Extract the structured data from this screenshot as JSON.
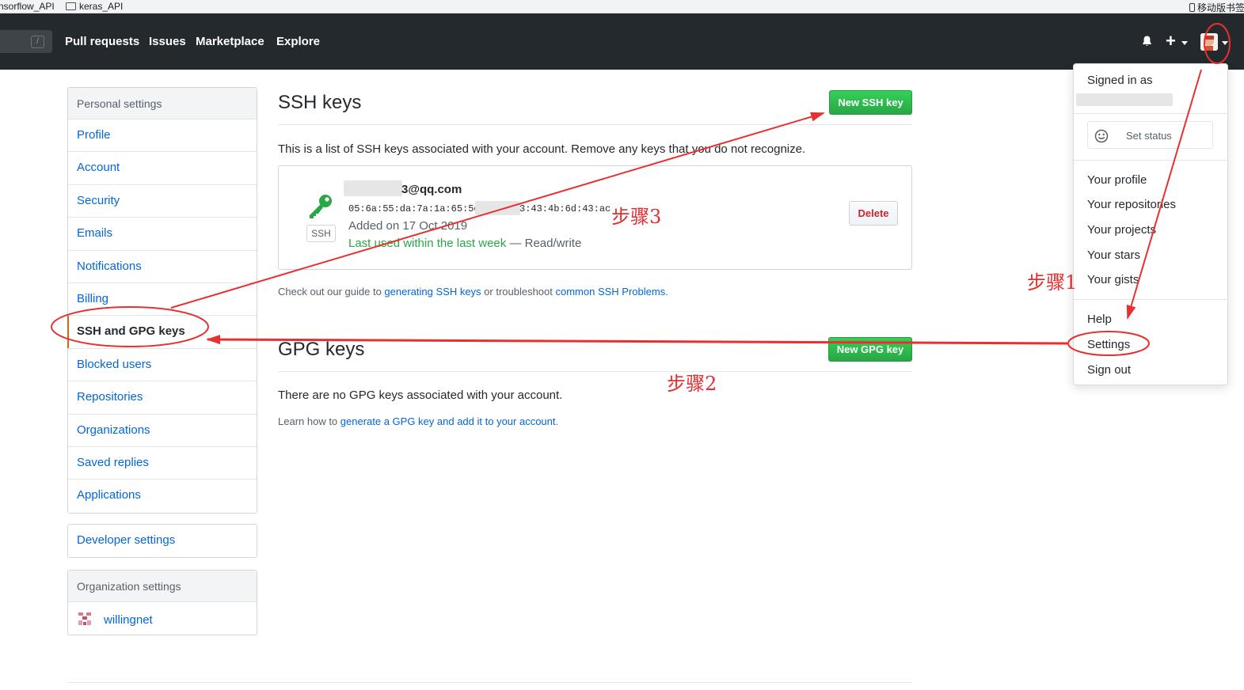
{
  "bookmarks": [
    {
      "label": "nsorflow_API"
    },
    {
      "label": "keras_API"
    },
    {
      "label": "移动版书签"
    }
  ],
  "header": {
    "search_shortcut": "/",
    "nav": [
      "Pull requests",
      "Issues",
      "Marketplace",
      "Explore"
    ],
    "plus": "+"
  },
  "sidebar": {
    "personal_heading": "Personal settings",
    "items": [
      "Profile",
      "Account",
      "Security",
      "Emails",
      "Notifications",
      "Billing",
      "SSH and GPG keys",
      "Blocked users",
      "Repositories",
      "Organizations",
      "Saved replies",
      "Applications"
    ],
    "selected": "SSH and GPG keys",
    "developer": "Developer settings",
    "org_heading": "Organization settings",
    "org_name": "willingnet"
  },
  "ssh": {
    "title": "SSH keys",
    "new_button": "New SSH key",
    "description": "This is a list of SSH keys associated with your account. Remove any keys that you do not recognize.",
    "key": {
      "email_suffix": "3@qq.com",
      "fingerprint_start": "05:6a:55:da:7a:1a:65:5c",
      "fingerprint_end": "3:43:4b:6d:43:ac",
      "badge": "SSH",
      "added": "Added on 17 Oct 2019",
      "last_used": "Last used within the last week",
      "access": " — Read/write",
      "delete": "Delete"
    },
    "guide_prefix": "Check out our guide to ",
    "guide_link1": "generating SSH keys",
    "guide_middle": " or troubleshoot ",
    "guide_link2": "common SSH Problems",
    "guide_suffix": "."
  },
  "gpg": {
    "title": "GPG keys",
    "new_button": "New GPG key",
    "empty": "There are no GPG keys associated with your account.",
    "learn_prefix": "Learn how to ",
    "learn_link": "generate a GPG key and add it to your account",
    "learn_suffix": "."
  },
  "dropdown": {
    "signed_in": "Signed in as",
    "set_status": "Set status",
    "items": [
      "Your profile",
      "Your repositories",
      "Your projects",
      "Your stars",
      "Your gists"
    ],
    "help": "Help",
    "settings": "Settings",
    "signout": "Sign out"
  },
  "annotations": {
    "step1": "步骤1",
    "step2": "步骤2",
    "step3": "步骤3",
    "color": "#e83030"
  }
}
